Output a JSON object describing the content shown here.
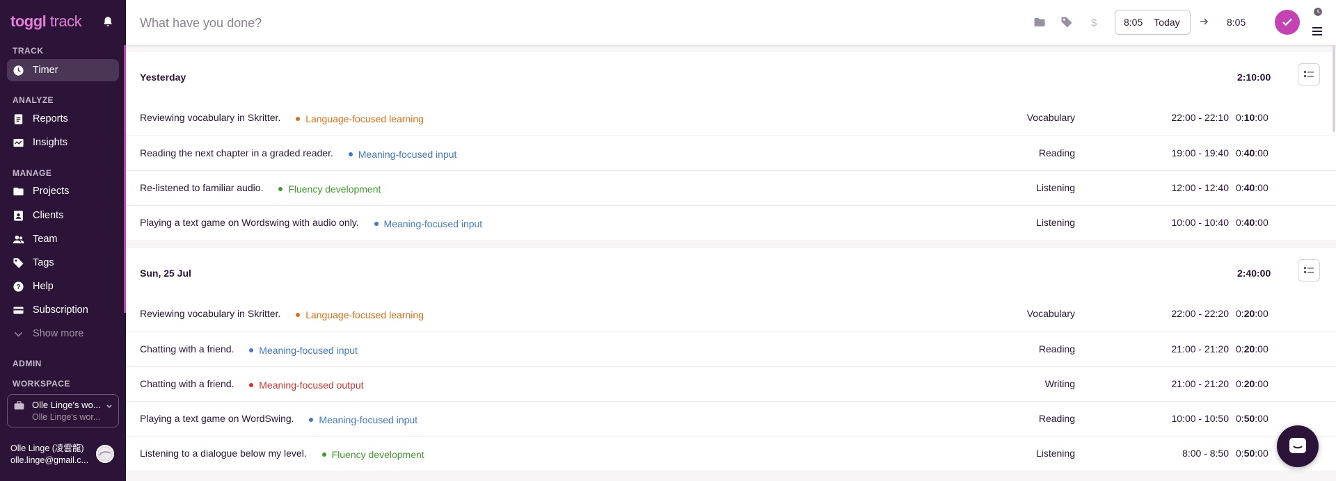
{
  "app": {
    "logo_brand": "toggl",
    "logo_product": "track"
  },
  "sidebar": {
    "sections": {
      "track": "TRACK",
      "analyze": "ANALYZE",
      "manage": "MANAGE",
      "admin": "ADMIN",
      "workspace": "WORKSPACE"
    },
    "items": [
      {
        "label": "Timer",
        "icon": "clock-icon",
        "active": true
      },
      {
        "label": "Reports",
        "icon": "report-icon"
      },
      {
        "label": "Insights",
        "icon": "insights-icon"
      },
      {
        "label": "Projects",
        "icon": "folder-icon"
      },
      {
        "label": "Clients",
        "icon": "client-icon"
      },
      {
        "label": "Team",
        "icon": "team-icon"
      },
      {
        "label": "Tags",
        "icon": "tag-icon"
      },
      {
        "label": "Help",
        "icon": "help-icon"
      },
      {
        "label": "Subscription",
        "icon": "card-icon"
      },
      {
        "label": "Show more",
        "icon": "chevron-down-icon"
      }
    ],
    "workspace": {
      "name": "Olle Linge's wo...",
      "sub": "Olle Linge's wor..."
    },
    "user": {
      "name": "Olle Linge (凌雲龍)",
      "email": "olle.linge@gmail.c..."
    }
  },
  "topbar": {
    "placeholder": "What have you done?",
    "start_time": "8:05",
    "date": "Today",
    "end_time": "8:05"
  },
  "groups": [
    {
      "title": "Yesterday",
      "total": "2:10:00",
      "entries": [
        {
          "desc": "Reviewing vocabulary in Skritter.",
          "project": "Language-focused learning",
          "color": "#e06e16",
          "tag": "Vocabulary",
          "range": "22:00 - 22:10",
          "dur_pre": "0:",
          "dur_bold": "10",
          "dur_post": ":00"
        },
        {
          "desc": "Reading the next chapter in a graded reader.",
          "project": "Meaning-focused input",
          "color": "#3d78cc",
          "tag": "Reading",
          "range": "19:00 - 19:40",
          "dur_pre": "0:",
          "dur_bold": "40",
          "dur_post": ":00"
        },
        {
          "desc": "Re-listened to familiar audio.",
          "project": "Fluency development",
          "color": "#3d9c27",
          "tag": "Listening",
          "range": "12:00 - 12:40",
          "dur_pre": "0:",
          "dur_bold": "40",
          "dur_post": ":00"
        },
        {
          "desc": "Playing a text game on Wordswing with audio only.",
          "project": "Meaning-focused input",
          "color": "#3d78cc",
          "tag": "Listening",
          "range": "10:00 - 10:40",
          "dur_pre": "0:",
          "dur_bold": "40",
          "dur_post": ":00"
        }
      ]
    },
    {
      "title": "Sun, 25 Jul",
      "total": "2:40:00",
      "entries": [
        {
          "desc": "Reviewing vocabulary in Skritter.",
          "project": "Language-focused learning",
          "color": "#e06e16",
          "tag": "Vocabulary",
          "range": "22:00 - 22:20",
          "dur_pre": "0:",
          "dur_bold": "20",
          "dur_post": ":00"
        },
        {
          "desc": "Chatting with a friend.",
          "project": "Meaning-focused input",
          "color": "#3d78cc",
          "tag": "Reading",
          "range": "21:00 - 21:20",
          "dur_pre": "0:",
          "dur_bold": "20",
          "dur_post": ":00"
        },
        {
          "desc": "Chatting with a friend.",
          "project": "Meaning-focused output",
          "color": "#d0342c",
          "tag": "Writing",
          "range": "21:00 - 21:20",
          "dur_pre": "0:",
          "dur_bold": "20",
          "dur_post": ":00"
        },
        {
          "desc": "Playing a text game on WordSwing.",
          "project": "Meaning-focused input",
          "color": "#3d78cc",
          "tag": "Reading",
          "range": "10:00 - 10:50",
          "dur_pre": "0:",
          "dur_bold": "50",
          "dur_post": ":00"
        },
        {
          "desc": "Listening to a dialogue below my level.",
          "project": "Fluency development",
          "color": "#3d9c27",
          "tag": "Listening",
          "range": "8:00 - 8:50",
          "dur_pre": "0:",
          "dur_bold": "50",
          "dur_post": ":00"
        }
      ]
    }
  ]
}
